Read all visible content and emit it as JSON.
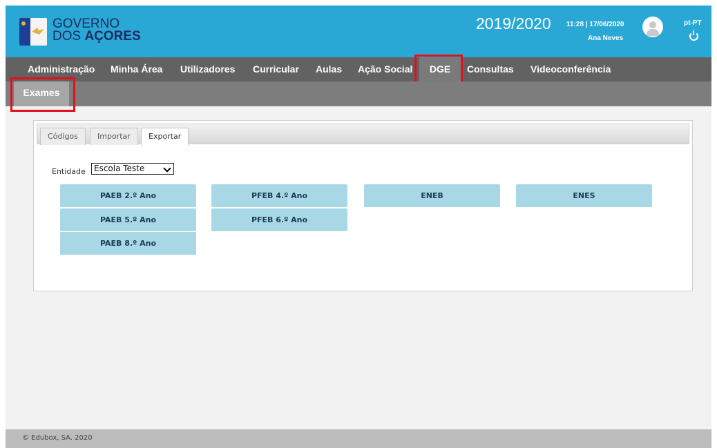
{
  "header": {
    "brand_line1": "GOVERNO",
    "brand_line2_prefix": "DOS ",
    "brand_line2_bold": "AÇORES",
    "school_year": "2019/2020",
    "time": "11:28",
    "date": "17/06/2020",
    "user_name": "Ana Neves",
    "language": "pt-PT",
    "icons": [
      "logo-flag",
      "user-avatar-icon",
      "power-icon"
    ]
  },
  "main_nav": [
    {
      "label": "Administração"
    },
    {
      "label": "Minha Área"
    },
    {
      "label": "Utilizadores"
    },
    {
      "label": "Curricular"
    },
    {
      "label": "Aulas"
    },
    {
      "label": "Ação Social"
    },
    {
      "label": "DGE",
      "active": true
    },
    {
      "label": "Consultas"
    },
    {
      "label": "Videoconferência"
    }
  ],
  "sub_nav": [
    {
      "label": "Exames",
      "active": true
    }
  ],
  "tabs": [
    {
      "label": "Códigos"
    },
    {
      "label": "Importar"
    },
    {
      "label": "Exportar",
      "active": true
    }
  ],
  "entity": {
    "label": "Entidade",
    "selected": "Escola Teste"
  },
  "exam_buttons": [
    {
      "label": "PAEB 2.º Ano"
    },
    {
      "label": "PFEB 4.º Ano"
    },
    {
      "label": "ENEB"
    },
    {
      "label": "ENES"
    },
    {
      "label": "PAEB 5.º Ano"
    },
    {
      "label": "PFEB 6.º Ano"
    },
    {
      "label": "PAEB 8.º Ano"
    }
  ],
  "footer": {
    "copyright": "© Edubox, SA. 2020"
  },
  "colors": {
    "header_bg": "#29a8d6",
    "nav_bg": "#626262",
    "subnav_bg": "#7d7d7d",
    "button_bg": "#a8d7e5",
    "highlight": "#e3101b"
  }
}
